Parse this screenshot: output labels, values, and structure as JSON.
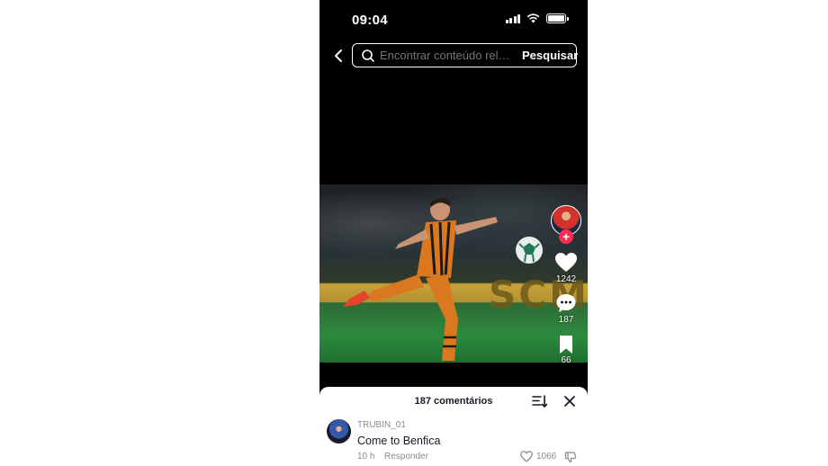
{
  "status_bar": {
    "time": "09:04"
  },
  "search": {
    "placeholder": "Encontrar conteúdo relacionado",
    "button_label": "Pesquisar"
  },
  "video": {
    "board_text": "SCM"
  },
  "actions": {
    "likes": "1242",
    "comments": "187",
    "saves": "66"
  },
  "comments_panel": {
    "title": "187 comentários",
    "comments": [
      {
        "username": "TRUBIN_01",
        "text": "Come to Benfica",
        "time": "10 h",
        "reply_label": "Responder",
        "likes": "1066"
      }
    ]
  },
  "icons": {
    "back": "chevron-left-icon",
    "search": "search-icon",
    "like": "heart-icon",
    "comment": "comment-bubble-icon",
    "save": "bookmark-icon",
    "sort": "sort-icon",
    "close": "close-icon",
    "dislike": "thumbs-down-icon"
  },
  "colors": {
    "accent": "#fe2c55",
    "background": "#000000",
    "panel": "#ffffff",
    "muted_text": "#8a8b91"
  }
}
